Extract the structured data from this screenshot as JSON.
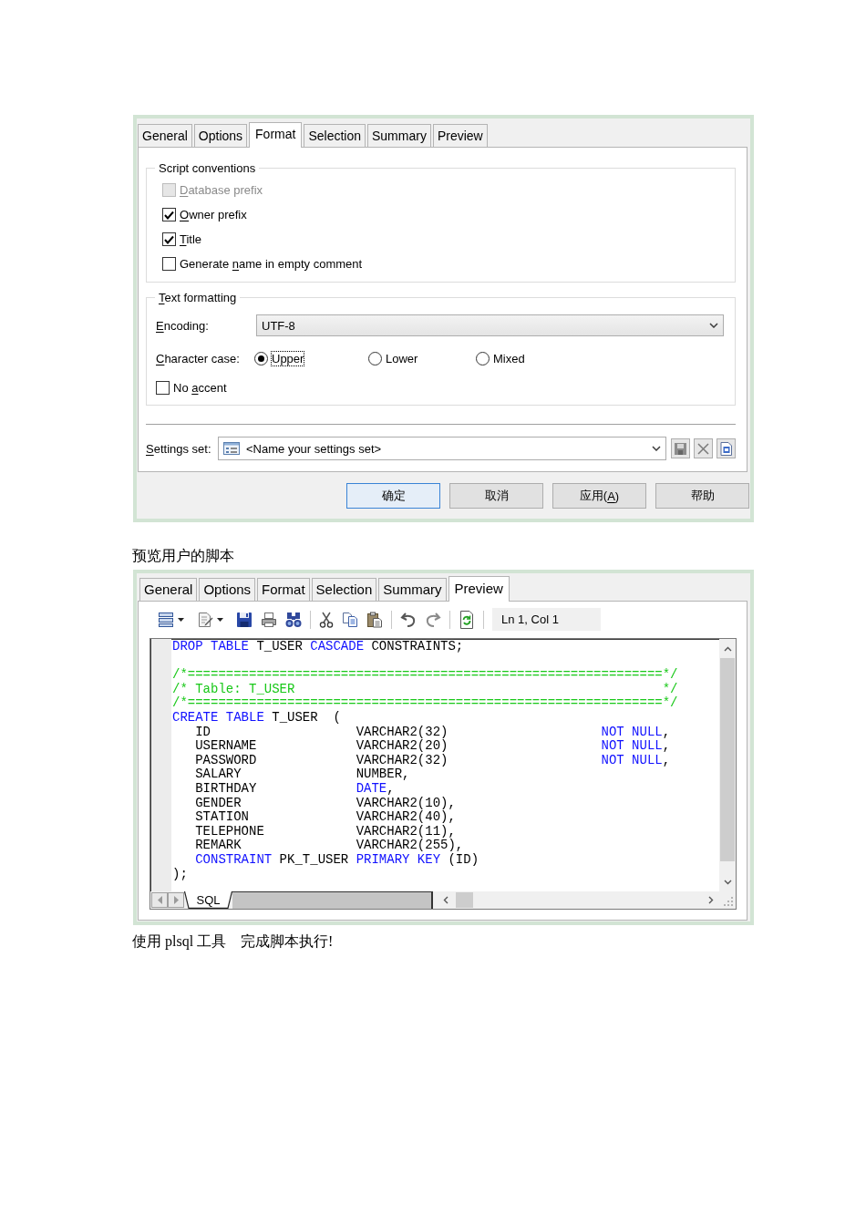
{
  "format_dialog": {
    "tabs": [
      {
        "label": "General",
        "selected": false
      },
      {
        "label": "Options",
        "selected": false
      },
      {
        "label": "Format",
        "selected": true
      },
      {
        "label": "Selection",
        "selected": false
      },
      {
        "label": "Summary",
        "selected": false
      },
      {
        "label": "Preview",
        "selected": false
      }
    ],
    "script_conventions": {
      "title": "Script conventions",
      "options": [
        {
          "label": [
            {
              "text": "D",
              "underline": true
            },
            {
              "text": "atabase prefix",
              "underline": false
            }
          ],
          "checked": false,
          "disabled": true
        },
        {
          "label": [
            {
              "text": "O",
              "underline": true
            },
            {
              "text": "wner prefix",
              "underline": false
            }
          ],
          "checked": true,
          "disabled": false
        },
        {
          "label": [
            {
              "text": "T",
              "underline": true
            },
            {
              "text": "itle",
              "underline": false
            }
          ],
          "checked": true,
          "disabled": false
        },
        {
          "label": [
            {
              "text": "Generate ",
              "underline": false
            },
            {
              "text": "n",
              "underline": true
            },
            {
              "text": "ame in empty comment",
              "underline": false
            }
          ],
          "checked": false,
          "disabled": false
        }
      ]
    },
    "text_formatting": {
      "title": [
        {
          "text": "T",
          "underline": true
        },
        {
          "text": "ext formatting",
          "underline": false
        }
      ],
      "encoding": {
        "label": [
          {
            "text": "E",
            "underline": true
          },
          {
            "text": "ncoding:",
            "underline": false
          }
        ],
        "value": "UTF-8"
      },
      "character_case": {
        "label": [
          {
            "text": "C",
            "underline": true
          },
          {
            "text": "haracter case:",
            "underline": false
          }
        ],
        "options": [
          {
            "label": "Upper",
            "selected": true,
            "focused": true
          },
          {
            "label": "Lower",
            "selected": false,
            "focused": false
          },
          {
            "label": "Mixed",
            "selected": false,
            "focused": false
          }
        ]
      },
      "no_accent": {
        "label": [
          {
            "text": "No ",
            "underline": false
          },
          {
            "text": "a",
            "underline": true
          },
          {
            "text": "ccent",
            "underline": false
          }
        ],
        "checked": false
      }
    },
    "settings_set": {
      "label": [
        {
          "text": "S",
          "underline": true
        },
        {
          "text": "ettings set:",
          "underline": false
        }
      ],
      "value": "<Name your settings set>"
    },
    "buttons": [
      {
        "label": [
          {
            "text": "确定",
            "underline": false
          }
        ],
        "default": true
      },
      {
        "label": [
          {
            "text": "取消",
            "underline": false
          }
        ],
        "default": false
      },
      {
        "label": [
          {
            "text": "应用(",
            "underline": false
          },
          {
            "text": "A",
            "underline": true
          },
          {
            "text": ")",
            "underline": false
          }
        ],
        "default": false
      },
      {
        "label": [
          {
            "text": "帮助",
            "underline": false
          }
        ],
        "default": false
      }
    ]
  },
  "preview_caption": "预览用户的脚本",
  "preview_dialog": {
    "tabs": [
      {
        "label": "General",
        "selected": false
      },
      {
        "label": "Options",
        "selected": false
      },
      {
        "label": "Format",
        "selected": false
      },
      {
        "label": "Selection",
        "selected": false
      },
      {
        "label": "Summary",
        "selected": false
      },
      {
        "label": "Preview",
        "selected": true
      }
    ],
    "cursor_position": "Ln 1, Col 1",
    "editor": {
      "lines": [
        {
          "kind": "code",
          "tokens": [
            {
              "text": "DROP TABLE",
              "kind": "keyword"
            },
            {
              "text": " T_USER ",
              "kind": "plain"
            },
            {
              "text": "CASCADE",
              "kind": "keyword"
            },
            {
              "text": " CONSTRAINTS;",
              "kind": "plain"
            }
          ]
        },
        {
          "kind": "blank"
        },
        {
          "kind": "code",
          "tokens": [
            {
              "text": "/*==============================================================*/",
              "kind": "comment"
            }
          ]
        },
        {
          "kind": "code",
          "tokens": [
            {
              "text": "/* Table: T_USER                                                */",
              "kind": "comment"
            }
          ]
        },
        {
          "kind": "code",
          "tokens": [
            {
              "text": "/*==============================================================*/",
              "kind": "comment"
            }
          ]
        },
        {
          "kind": "code",
          "tokens": [
            {
              "text": "CREATE TABLE",
              "kind": "keyword"
            },
            {
              "text": " T_USER  (",
              "kind": "plain"
            }
          ]
        },
        {
          "kind": "code",
          "tokens": [
            {
              "text": "   ID                   VARCHAR2(32)                    ",
              "kind": "plain"
            },
            {
              "text": "NOT NULL",
              "kind": "keyword"
            },
            {
              "text": ",",
              "kind": "plain"
            }
          ]
        },
        {
          "kind": "code",
          "tokens": [
            {
              "text": "   USERNAME             VARCHAR2(20)                    ",
              "kind": "plain"
            },
            {
              "text": "NOT NULL",
              "kind": "keyword"
            },
            {
              "text": ",",
              "kind": "plain"
            }
          ]
        },
        {
          "kind": "code",
          "tokens": [
            {
              "text": "   PASSWORD             VARCHAR2(32)                    ",
              "kind": "plain"
            },
            {
              "text": "NOT NULL",
              "kind": "keyword"
            },
            {
              "text": ",",
              "kind": "plain"
            }
          ]
        },
        {
          "kind": "code",
          "tokens": [
            {
              "text": "   SALARY               NUMBER,",
              "kind": "plain"
            }
          ]
        },
        {
          "kind": "code",
          "tokens": [
            {
              "text": "   BIRTHDAY             ",
              "kind": "plain"
            },
            {
              "text": "DATE",
              "kind": "keyword"
            },
            {
              "text": ",",
              "kind": "plain"
            }
          ]
        },
        {
          "kind": "code",
          "tokens": [
            {
              "text": "   GENDER               VARCHAR2(10),",
              "kind": "plain"
            }
          ]
        },
        {
          "kind": "code",
          "tokens": [
            {
              "text": "   STATION              VARCHAR2(40),",
              "kind": "plain"
            }
          ]
        },
        {
          "kind": "code",
          "tokens": [
            {
              "text": "   TELEPHONE            VARCHAR2(11),",
              "kind": "plain"
            }
          ]
        },
        {
          "kind": "code",
          "tokens": [
            {
              "text": "   REMARK               VARCHAR2(255),",
              "kind": "plain"
            }
          ]
        },
        {
          "kind": "code",
          "tokens": [
            {
              "text": "   CONSTRAINT",
              "kind": "keyword"
            },
            {
              "text": " PK_T_USER ",
              "kind": "plain"
            },
            {
              "text": "PRIMARY KEY",
              "kind": "keyword"
            },
            {
              "text": " (ID)",
              "kind": "plain"
            }
          ]
        },
        {
          "kind": "code",
          "tokens": [
            {
              "text": ");",
              "kind": "plain"
            }
          ]
        }
      ]
    },
    "sheet_tabs": [
      {
        "label": "SQL",
        "selected": true
      }
    ]
  },
  "closing_text": "使用 plsql 工具　完成脚本执行!"
}
